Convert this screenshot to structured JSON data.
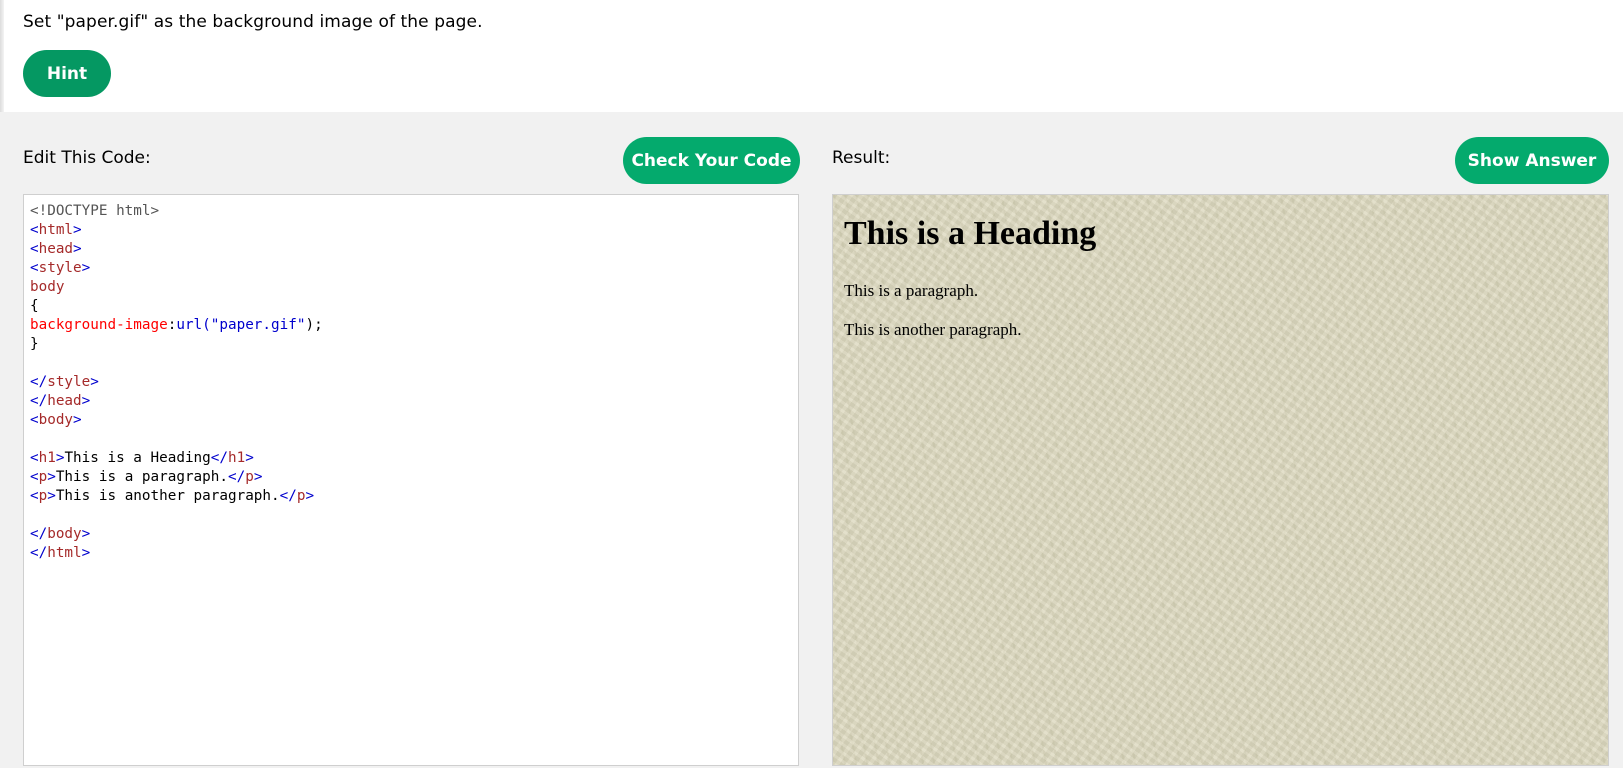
{
  "exercise": {
    "instruction": "Set \"paper.gif\" as the background image of the page.",
    "hint_label": "Hint"
  },
  "editor": {
    "label": "Edit This Code:",
    "check_label": "Check Your Code",
    "lines": [
      "<!DOCTYPE html>",
      "<html>",
      "<head>",
      "<style>",
      "body",
      "{",
      "background-image:url(\"paper.gif\");",
      "}",
      "",
      "</style>",
      "</head>",
      "<body>",
      "",
      "<h1>This is a Heading</h1>",
      "<p>This is a paragraph.</p>",
      "<p>This is another paragraph.</p>",
      "",
      "</body>",
      "</html>"
    ]
  },
  "result": {
    "label": "Result:",
    "show_answer_label": "Show Answer",
    "heading": "This is a Heading",
    "paragraph1": "This is a paragraph.",
    "paragraph2": "This is another paragraph."
  },
  "colors": {
    "button_green": "#04aa6d",
    "hint_green": "#059862",
    "work_area_bg": "#f1f1f1",
    "paper_bg": "#dcd8bd",
    "code_tag": "#a52a2a",
    "code_bracket": "#0000cd",
    "code_property": "#ff0000",
    "code_value": "#0000cd"
  }
}
